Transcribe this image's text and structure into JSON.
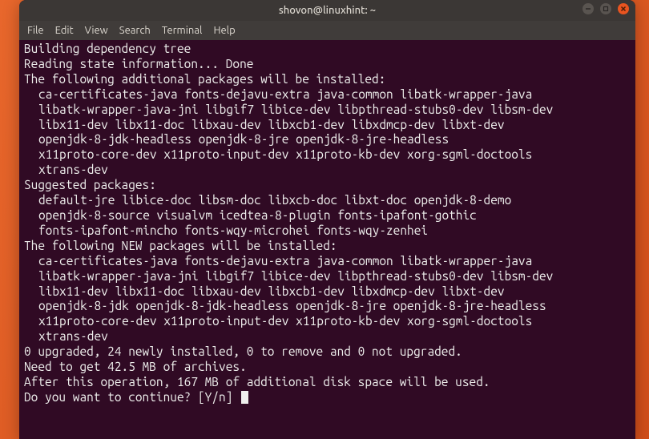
{
  "title": "shovon@linuxhint: ~",
  "menu": [
    "File",
    "Edit",
    "View",
    "Search",
    "Terminal",
    "Help"
  ],
  "lines": [
    {
      "t": "Building dependency tree",
      "i": false
    },
    {
      "t": "Reading state information... Done",
      "i": false
    },
    {
      "t": "The following additional packages will be installed:",
      "i": false
    },
    {
      "t": "ca-certificates-java fonts-dejavu-extra java-common libatk-wrapper-java",
      "i": true
    },
    {
      "t": "libatk-wrapper-java-jni libgif7 libice-dev libpthread-stubs0-dev libsm-dev",
      "i": true
    },
    {
      "t": "libx11-dev libx11-doc libxau-dev libxcb1-dev libxdmcp-dev libxt-dev",
      "i": true
    },
    {
      "t": "openjdk-8-jdk-headless openjdk-8-jre openjdk-8-jre-headless",
      "i": true
    },
    {
      "t": "x11proto-core-dev x11proto-input-dev x11proto-kb-dev xorg-sgml-doctools",
      "i": true
    },
    {
      "t": "xtrans-dev",
      "i": true
    },
    {
      "t": "Suggested packages:",
      "i": false
    },
    {
      "t": "default-jre libice-doc libsm-doc libxcb-doc libxt-doc openjdk-8-demo",
      "i": true
    },
    {
      "t": "openjdk-8-source visualvm icedtea-8-plugin fonts-ipafont-gothic",
      "i": true
    },
    {
      "t": "fonts-ipafont-mincho fonts-wqy-microhei fonts-wqy-zenhei",
      "i": true
    },
    {
      "t": "The following NEW packages will be installed:",
      "i": false
    },
    {
      "t": "ca-certificates-java fonts-dejavu-extra java-common libatk-wrapper-java",
      "i": true
    },
    {
      "t": "libatk-wrapper-java-jni libgif7 libice-dev libpthread-stubs0-dev libsm-dev",
      "i": true
    },
    {
      "t": "libx11-dev libx11-doc libxau-dev libxcb1-dev libxdmcp-dev libxt-dev",
      "i": true
    },
    {
      "t": "openjdk-8-jdk openjdk-8-jdk-headless openjdk-8-jre openjdk-8-jre-headless",
      "i": true
    },
    {
      "t": "x11proto-core-dev x11proto-input-dev x11proto-kb-dev xorg-sgml-doctools",
      "i": true
    },
    {
      "t": "xtrans-dev",
      "i": true
    },
    {
      "t": "0 upgraded, 24 newly installed, 0 to remove and 0 not upgraded.",
      "i": false
    },
    {
      "t": "Need to get 42.5 MB of archives.",
      "i": false
    },
    {
      "t": "After this operation, 167 MB of additional disk space will be used.",
      "i": false
    }
  ],
  "prompt": "Do you want to continue? [Y/n] ",
  "controls": {
    "min": "−",
    "max": "□",
    "close": "×"
  }
}
